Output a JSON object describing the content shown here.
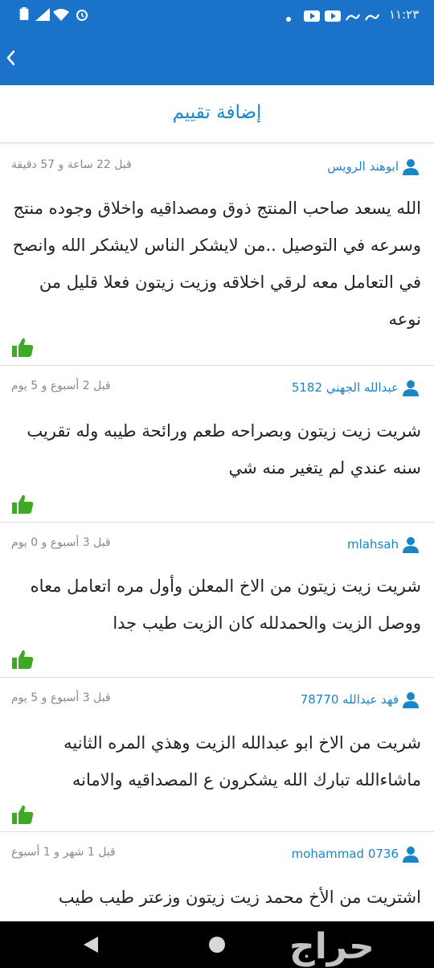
{
  "status_bar": {
    "time": "١١:٢٣",
    "left_icons": [
      "battery-icon",
      "signal-icon",
      "wifi-icon",
      "alarm-icon"
    ],
    "right_icons": [
      "notification-dot-icon",
      "youtube-icon",
      "youtube-icon",
      "haraj-icon",
      "haraj-icon"
    ]
  },
  "header": {
    "back_icon": "chevron-left-icon",
    "background": "#1a73c8"
  },
  "add_review": {
    "label": "إضافة تقييم",
    "color": "#1a85c7"
  },
  "reviews": [
    {
      "user": "ابوهند الرويس",
      "time": "قبل 22 ساعة و 57 دقيقة",
      "text": "الله يسعد صاحب المنتج ذوق ومصداقيه واخلاق وجوده منتج وسرعه في التوصيل ..من لايشكر الناس لايشكر الله وانصح في التعامل معه لرقي اخلاقه وزيت زيتون فعلا قليل من نوعه"
    },
    {
      "user": "عبدالله الجهني 5182",
      "time": "قبل 2 أسبوع و 5 يوم",
      "text": "شريت زيت زيتون وبصراحه طعم ورائحة طيبه وله تقريب سنه عندي لم يتغير منه شي"
    },
    {
      "user": "mlahsah",
      "time": "قبل 3 أسبوع و 0 يوم",
      "text": "شريت زيت زيتون من الاخ المعلن وأول مره اتعامل معاه ووصل الزيت والحمدلله كان الزيت طيب جدا"
    },
    {
      "user": "فهد عبدالله 78770",
      "time": "قبل 3 أسبوع و 5 يوم",
      "text": "شريت من الاخ ابو عبدالله الزيت وهذي المره الثانيه ماشاءالله تبارك الله يشكرون ع المصداقيه والامانه"
    },
    {
      "user": "mohammad 0736",
      "time": "قبل 1 شهر و 1 أسبوع",
      "text": "اشتريت من الأخ محمد زيت زيتون وزعتر طيب طيب"
    }
  ],
  "colors": {
    "like": "#3ea924",
    "user_icon": "#1a85c7"
  },
  "nav": {
    "watermark": "حراج"
  }
}
